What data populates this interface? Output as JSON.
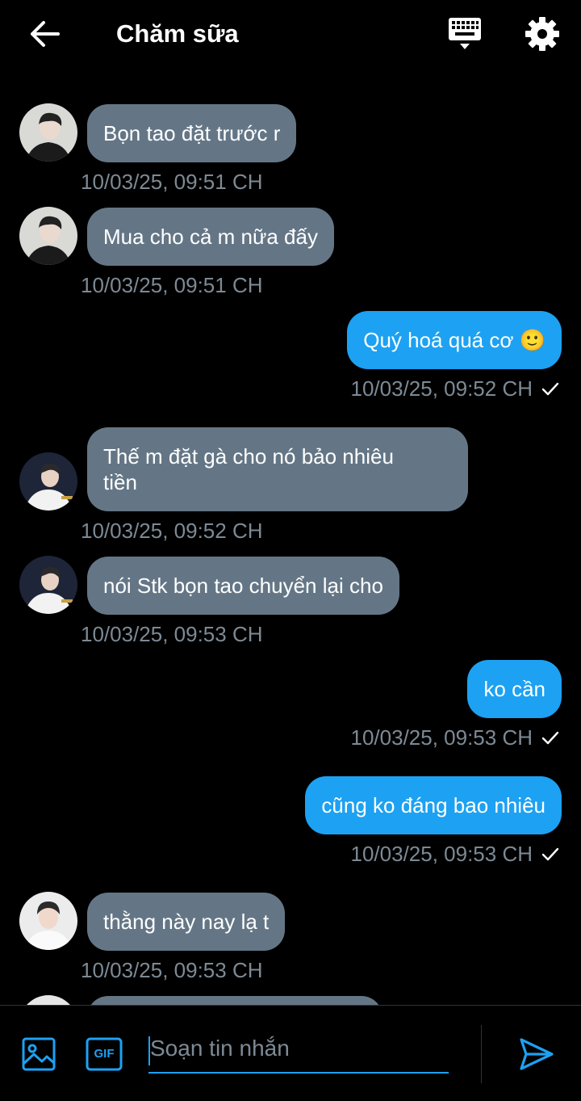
{
  "header": {
    "title": "Chăm sữa",
    "back_icon": "arrow-left-icon",
    "keyboard_icon": "keyboard-icon",
    "settings_icon": "gear-icon"
  },
  "messages": [
    {
      "direction": "in",
      "text": "Bọn tao đặt trước r",
      "time": "10/03/25, 09:51 CH"
    },
    {
      "direction": "in",
      "text": "Mua cho cả m nữa đấy",
      "time": "10/03/25, 09:51 CH"
    },
    {
      "direction": "out",
      "text": "Quý hoá quá cơ 🙂",
      "time": "10/03/25, 09:52 CH",
      "read": true
    },
    {
      "direction": "in",
      "text_line1": "Thế m đặt gà cho nó bảo nhiêu",
      "text_line2": "tiền",
      "time": "10/03/25, 09:52 CH"
    },
    {
      "direction": "in",
      "text": "nói Stk bọn tao chuyển lại cho",
      "time": "10/03/25, 09:53 CH"
    },
    {
      "direction": "out",
      "text": "ko cần",
      "time": "10/03/25, 09:53 CH",
      "read": true
    },
    {
      "direction": "out",
      "text": "cũng ko đáng bao nhiêu",
      "time": "10/03/25, 09:53 CH",
      "read": true
    },
    {
      "direction": "in",
      "text": "thằng này nay lạ t",
      "time": "10/03/25, 09:53 CH"
    }
  ],
  "composer": {
    "placeholder": "Soạn tin nhắn",
    "image_icon": "image-icon",
    "gif_label": "GIF",
    "send_icon": "send-icon"
  },
  "colors": {
    "incoming_bubble": "#647686",
    "outgoing_bubble": "#1da1f2",
    "timestamp": "#7d8a95",
    "background": "#000000"
  }
}
